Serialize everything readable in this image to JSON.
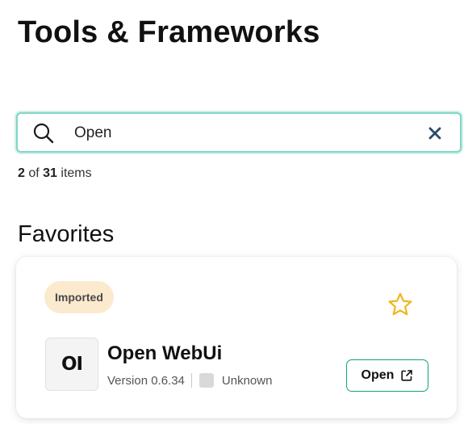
{
  "header": {
    "title": "Tools & Frameworks"
  },
  "search": {
    "value": "Open",
    "placeholder": "",
    "search_icon": "search-icon",
    "clear_icon": "close-icon"
  },
  "results": {
    "shown": "2",
    "of_label": "of",
    "total": "31",
    "items_label": "items"
  },
  "favorites": {
    "section_title": "Favorites",
    "cards": [
      {
        "badge": "Imported",
        "favorite_icon": "star-outline-icon",
        "favorite_color": "#f2b51f",
        "logo_text": "OI",
        "name": "Open WebUi",
        "version": "Version 0.6.34",
        "status": "Unknown",
        "open_label": "Open",
        "open_icon": "external-link-icon"
      }
    ]
  },
  "colors": {
    "accent": "#01a982",
    "badge_bg": "#fbeacd",
    "clear_icon": "#2b4a6e"
  }
}
